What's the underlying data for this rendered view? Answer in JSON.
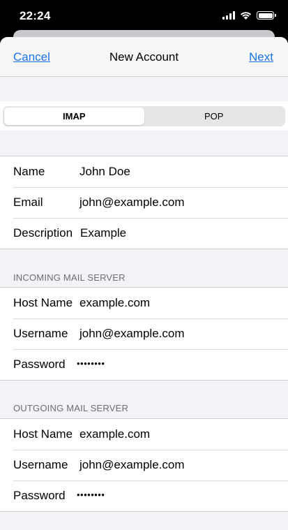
{
  "status_bar": {
    "time": "22:24"
  },
  "nav": {
    "cancel": "Cancel",
    "title": "New Account",
    "next": "Next"
  },
  "account_type": {
    "options": [
      "IMAP",
      "POP"
    ],
    "selected": "IMAP"
  },
  "account": {
    "name_label": "Name",
    "name_value": "John Doe",
    "email_label": "Email",
    "email_value": "john@example.com",
    "description_label": "Description",
    "description_value": "Example"
  },
  "incoming": {
    "header": "INCOMING MAIL SERVER",
    "host_label": "Host Name",
    "host_value": "example.com",
    "user_label": "Username",
    "user_value": "john@example.com",
    "password_label": "Password",
    "password_value": "••••••••"
  },
  "outgoing": {
    "header": "OUTGOING MAIL SERVER",
    "host_label": "Host Name",
    "host_value": "example.com",
    "user_label": "Username",
    "user_value": "john@example.com",
    "password_label": "Password",
    "password_value": "••••••••"
  },
  "colors": {
    "link": "#1a73e8",
    "background": "#f2f2f7",
    "section_header": "#6d6d72"
  }
}
